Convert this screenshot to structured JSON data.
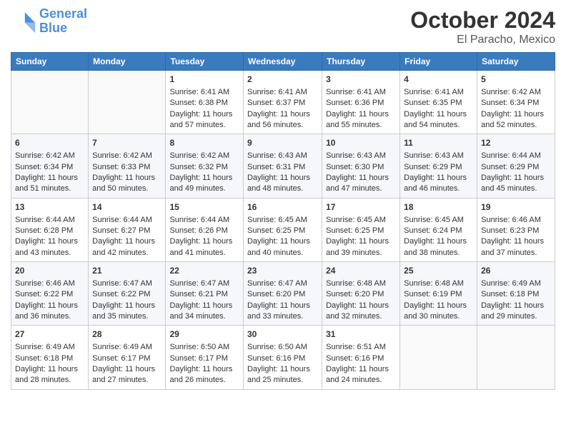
{
  "logo": {
    "line1": "General",
    "line2": "Blue"
  },
  "title": "October 2024",
  "location": "El Paracho, Mexico",
  "weekdays": [
    "Sunday",
    "Monday",
    "Tuesday",
    "Wednesday",
    "Thursday",
    "Friday",
    "Saturday"
  ],
  "weeks": [
    [
      {
        "day": "",
        "sunrise": "",
        "sunset": "",
        "daylight": ""
      },
      {
        "day": "",
        "sunrise": "",
        "sunset": "",
        "daylight": ""
      },
      {
        "day": "1",
        "sunrise": "Sunrise: 6:41 AM",
        "sunset": "Sunset: 6:38 PM",
        "daylight": "Daylight: 11 hours and 57 minutes."
      },
      {
        "day": "2",
        "sunrise": "Sunrise: 6:41 AM",
        "sunset": "Sunset: 6:37 PM",
        "daylight": "Daylight: 11 hours and 56 minutes."
      },
      {
        "day": "3",
        "sunrise": "Sunrise: 6:41 AM",
        "sunset": "Sunset: 6:36 PM",
        "daylight": "Daylight: 11 hours and 55 minutes."
      },
      {
        "day": "4",
        "sunrise": "Sunrise: 6:41 AM",
        "sunset": "Sunset: 6:35 PM",
        "daylight": "Daylight: 11 hours and 54 minutes."
      },
      {
        "day": "5",
        "sunrise": "Sunrise: 6:42 AM",
        "sunset": "Sunset: 6:34 PM",
        "daylight": "Daylight: 11 hours and 52 minutes."
      }
    ],
    [
      {
        "day": "6",
        "sunrise": "Sunrise: 6:42 AM",
        "sunset": "Sunset: 6:34 PM",
        "daylight": "Daylight: 11 hours and 51 minutes."
      },
      {
        "day": "7",
        "sunrise": "Sunrise: 6:42 AM",
        "sunset": "Sunset: 6:33 PM",
        "daylight": "Daylight: 11 hours and 50 minutes."
      },
      {
        "day": "8",
        "sunrise": "Sunrise: 6:42 AM",
        "sunset": "Sunset: 6:32 PM",
        "daylight": "Daylight: 11 hours and 49 minutes."
      },
      {
        "day": "9",
        "sunrise": "Sunrise: 6:43 AM",
        "sunset": "Sunset: 6:31 PM",
        "daylight": "Daylight: 11 hours and 48 minutes."
      },
      {
        "day": "10",
        "sunrise": "Sunrise: 6:43 AM",
        "sunset": "Sunset: 6:30 PM",
        "daylight": "Daylight: 11 hours and 47 minutes."
      },
      {
        "day": "11",
        "sunrise": "Sunrise: 6:43 AM",
        "sunset": "Sunset: 6:29 PM",
        "daylight": "Daylight: 11 hours and 46 minutes."
      },
      {
        "day": "12",
        "sunrise": "Sunrise: 6:44 AM",
        "sunset": "Sunset: 6:29 PM",
        "daylight": "Daylight: 11 hours and 45 minutes."
      }
    ],
    [
      {
        "day": "13",
        "sunrise": "Sunrise: 6:44 AM",
        "sunset": "Sunset: 6:28 PM",
        "daylight": "Daylight: 11 hours and 43 minutes."
      },
      {
        "day": "14",
        "sunrise": "Sunrise: 6:44 AM",
        "sunset": "Sunset: 6:27 PM",
        "daylight": "Daylight: 11 hours and 42 minutes."
      },
      {
        "day": "15",
        "sunrise": "Sunrise: 6:44 AM",
        "sunset": "Sunset: 6:26 PM",
        "daylight": "Daylight: 11 hours and 41 minutes."
      },
      {
        "day": "16",
        "sunrise": "Sunrise: 6:45 AM",
        "sunset": "Sunset: 6:25 PM",
        "daylight": "Daylight: 11 hours and 40 minutes."
      },
      {
        "day": "17",
        "sunrise": "Sunrise: 6:45 AM",
        "sunset": "Sunset: 6:25 PM",
        "daylight": "Daylight: 11 hours and 39 minutes."
      },
      {
        "day": "18",
        "sunrise": "Sunrise: 6:45 AM",
        "sunset": "Sunset: 6:24 PM",
        "daylight": "Daylight: 11 hours and 38 minutes."
      },
      {
        "day": "19",
        "sunrise": "Sunrise: 6:46 AM",
        "sunset": "Sunset: 6:23 PM",
        "daylight": "Daylight: 11 hours and 37 minutes."
      }
    ],
    [
      {
        "day": "20",
        "sunrise": "Sunrise: 6:46 AM",
        "sunset": "Sunset: 6:22 PM",
        "daylight": "Daylight: 11 hours and 36 minutes."
      },
      {
        "day": "21",
        "sunrise": "Sunrise: 6:47 AM",
        "sunset": "Sunset: 6:22 PM",
        "daylight": "Daylight: 11 hours and 35 minutes."
      },
      {
        "day": "22",
        "sunrise": "Sunrise: 6:47 AM",
        "sunset": "Sunset: 6:21 PM",
        "daylight": "Daylight: 11 hours and 34 minutes."
      },
      {
        "day": "23",
        "sunrise": "Sunrise: 6:47 AM",
        "sunset": "Sunset: 6:20 PM",
        "daylight": "Daylight: 11 hours and 33 minutes."
      },
      {
        "day": "24",
        "sunrise": "Sunrise: 6:48 AM",
        "sunset": "Sunset: 6:20 PM",
        "daylight": "Daylight: 11 hours and 32 minutes."
      },
      {
        "day": "25",
        "sunrise": "Sunrise: 6:48 AM",
        "sunset": "Sunset: 6:19 PM",
        "daylight": "Daylight: 11 hours and 30 minutes."
      },
      {
        "day": "26",
        "sunrise": "Sunrise: 6:49 AM",
        "sunset": "Sunset: 6:18 PM",
        "daylight": "Daylight: 11 hours and 29 minutes."
      }
    ],
    [
      {
        "day": "27",
        "sunrise": "Sunrise: 6:49 AM",
        "sunset": "Sunset: 6:18 PM",
        "daylight": "Daylight: 11 hours and 28 minutes."
      },
      {
        "day": "28",
        "sunrise": "Sunrise: 6:49 AM",
        "sunset": "Sunset: 6:17 PM",
        "daylight": "Daylight: 11 hours and 27 minutes."
      },
      {
        "day": "29",
        "sunrise": "Sunrise: 6:50 AM",
        "sunset": "Sunset: 6:17 PM",
        "daylight": "Daylight: 11 hours and 26 minutes."
      },
      {
        "day": "30",
        "sunrise": "Sunrise: 6:50 AM",
        "sunset": "Sunset: 6:16 PM",
        "daylight": "Daylight: 11 hours and 25 minutes."
      },
      {
        "day": "31",
        "sunrise": "Sunrise: 6:51 AM",
        "sunset": "Sunset: 6:16 PM",
        "daylight": "Daylight: 11 hours and 24 minutes."
      },
      {
        "day": "",
        "sunrise": "",
        "sunset": "",
        "daylight": ""
      },
      {
        "day": "",
        "sunrise": "",
        "sunset": "",
        "daylight": ""
      }
    ]
  ]
}
